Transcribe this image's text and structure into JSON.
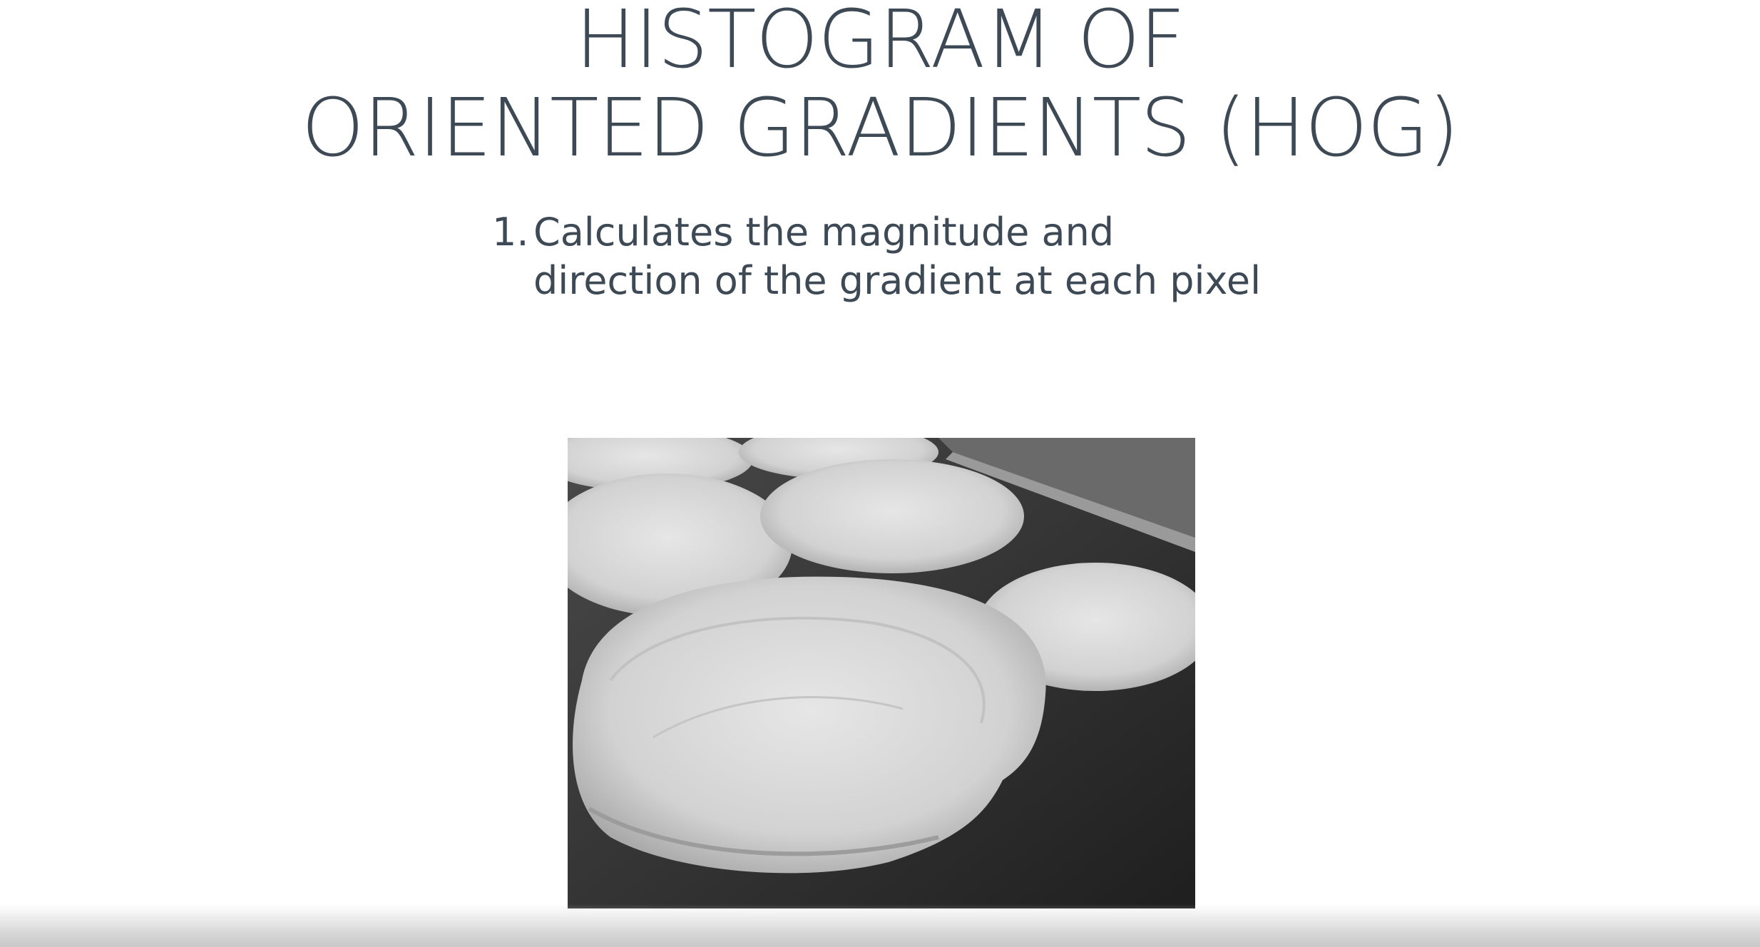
{
  "slide": {
    "title_line1": "HISTOGRAM OF",
    "title_line2": "ORIENTED GRADIENTS (HOG)",
    "step_number": "1.",
    "step_line1": "Calculates the magnitude and",
    "step_line2": "direction of the gradient at each pixel"
  },
  "image": {
    "subject": "grayscale photo of pancakes on a griddle"
  },
  "colors": {
    "text": "#3d4a56",
    "background": "#ffffff"
  }
}
